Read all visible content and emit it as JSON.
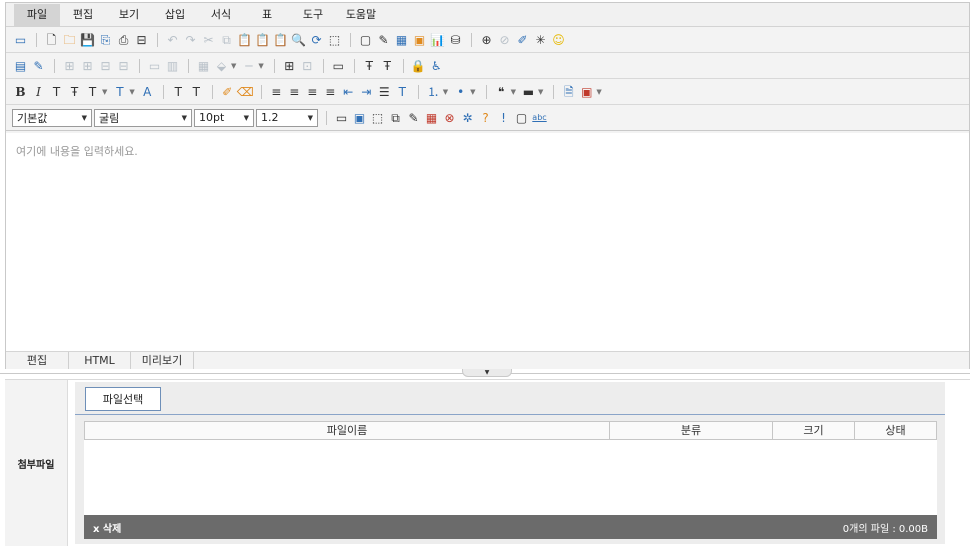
{
  "menu": [
    {
      "label": "파일",
      "name": "menu-file",
      "active": true
    },
    {
      "label": "편집",
      "name": "menu-edit"
    },
    {
      "label": "보기",
      "name": "menu-view"
    },
    {
      "label": "삽입",
      "name": "menu-insert"
    },
    {
      "label": "서식",
      "name": "menu-format"
    },
    {
      "label": "표",
      "name": "menu-table"
    },
    {
      "label": "도구",
      "name": "menu-tools"
    },
    {
      "label": "도움말",
      "name": "menu-help"
    }
  ],
  "toolbar1": [
    {
      "icon": "▭",
      "name": "open-icon",
      "cls": "g-blue"
    },
    {
      "sep": true
    },
    {
      "icon": "🗋",
      "name": "new-document-icon",
      "cls": "g-dark"
    },
    {
      "icon": "🗀",
      "name": "template-icon",
      "cls": "g-orange"
    },
    {
      "icon": "💾",
      "name": "save-icon",
      "cls": "g-blue"
    },
    {
      "icon": "⎘",
      "name": "save-as-icon",
      "cls": "g-blue"
    },
    {
      "icon": "⎙",
      "name": "print-icon",
      "cls": "g-dark"
    },
    {
      "icon": "⊟",
      "name": "page-setup-icon",
      "cls": "g-dark"
    },
    {
      "sep": true
    },
    {
      "icon": "↶",
      "name": "undo-icon",
      "cls": "dis"
    },
    {
      "icon": "↷",
      "name": "redo-icon",
      "cls": "dis"
    },
    {
      "icon": "✂",
      "name": "cut-icon",
      "cls": "dis"
    },
    {
      "icon": "⧉",
      "name": "copy-icon",
      "cls": "dis"
    },
    {
      "icon": "📋",
      "name": "paste-icon",
      "cls": "dis"
    },
    {
      "icon": "📋",
      "name": "paste-special-icon",
      "cls": "g-orange"
    },
    {
      "icon": "📋",
      "name": "paste-text-icon",
      "cls": "g-orange"
    },
    {
      "icon": "🔍",
      "name": "find-icon",
      "cls": "g-dark"
    },
    {
      "icon": "⟳",
      "name": "replace-icon",
      "cls": "g-blue"
    },
    {
      "icon": "⬚",
      "name": "select-all-icon",
      "cls": "g-dark"
    },
    {
      "sep": true
    },
    {
      "icon": "▢",
      "name": "image-icon",
      "cls": "g-dark"
    },
    {
      "icon": "✎",
      "name": "edit-image-icon",
      "cls": "g-dark"
    },
    {
      "icon": "▦",
      "name": "background-image-icon",
      "cls": "g-blue"
    },
    {
      "icon": "▣",
      "name": "media-icon",
      "cls": "g-orange"
    },
    {
      "icon": "📊",
      "name": "chart-icon",
      "cls": "g-blue"
    },
    {
      "icon": "⛁",
      "name": "link-icon",
      "cls": "g-dark"
    },
    {
      "sep": true
    },
    {
      "icon": "⊕",
      "name": "hyperlink-icon",
      "cls": "g-dark"
    },
    {
      "icon": "⊘",
      "name": "unlink-icon",
      "cls": "dis"
    },
    {
      "icon": "✐",
      "name": "pen-icon",
      "cls": "g-blue"
    },
    {
      "icon": "✳",
      "name": "special-char-icon",
      "cls": "g-dark"
    },
    {
      "icon": "☺",
      "name": "emoticon-icon",
      "cls": "g-yellow"
    }
  ],
  "toolbar2": [
    {
      "icon": "▤",
      "name": "table-icon",
      "cls": "g-blue"
    },
    {
      "icon": "✎",
      "name": "table-edit-icon",
      "cls": "g-blue"
    },
    {
      "sep": true
    },
    {
      "icon": "⊞",
      "name": "insert-row-icon",
      "cls": "dis"
    },
    {
      "icon": "⊞",
      "name": "insert-column-icon",
      "cls": "dis"
    },
    {
      "icon": "⊟",
      "name": "delete-row-icon",
      "cls": "dis"
    },
    {
      "icon": "⊟",
      "name": "delete-column-icon",
      "cls": "dis"
    },
    {
      "sep": true
    },
    {
      "icon": "▭",
      "name": "merge-cells-icon",
      "cls": "dis"
    },
    {
      "icon": "▥",
      "name": "split-cells-icon",
      "cls": "dis"
    },
    {
      "sep": true
    },
    {
      "icon": "▦",
      "name": "cell-properties-icon",
      "cls": "dis"
    },
    {
      "icon": "⬙",
      "name": "cell-fill-icon",
      "cls": "dis"
    },
    {
      "drop": true
    },
    {
      "icon": "─",
      "name": "cell-border-icon",
      "cls": "dis"
    },
    {
      "drop": true
    },
    {
      "sep": true
    },
    {
      "icon": "⊞",
      "name": "table-grid-icon",
      "cls": "g-dark"
    },
    {
      "icon": "⊡",
      "name": "table-outline-icon",
      "cls": "dis"
    },
    {
      "sep": true
    },
    {
      "icon": "▭",
      "name": "layer-icon",
      "cls": "g-dark"
    },
    {
      "sep": true
    },
    {
      "icon": "Ŧ",
      "name": "text-style-icon",
      "cls": "g-dark"
    },
    {
      "icon": "Ŧ",
      "name": "text-style-clear-icon",
      "cls": "g-dark"
    },
    {
      "sep": true
    },
    {
      "icon": "🔒",
      "name": "lock-icon",
      "cls": "g-orange"
    },
    {
      "icon": "♿",
      "name": "accessibility-icon",
      "cls": "g-blue"
    }
  ],
  "toolbar3": [
    {
      "icon": "B",
      "name": "bold-icon",
      "cls": "g-dark"
    },
    {
      "icon": "I",
      "name": "italic-icon",
      "cls": "g-dark"
    },
    {
      "icon": "T",
      "name": "underline-icon",
      "cls": "g-dark"
    },
    {
      "icon": "Ŧ",
      "name": "strikethrough-icon",
      "cls": "g-dark"
    },
    {
      "icon": "T",
      "name": "font-color-icon",
      "cls": "g-dark"
    },
    {
      "drop": true
    },
    {
      "icon": "T",
      "name": "background-color-icon",
      "cls": "g-blue"
    },
    {
      "drop": true
    },
    {
      "icon": "A",
      "name": "clear-format-icon",
      "cls": "g-blue"
    },
    {
      "sep": true
    },
    {
      "icon": "T",
      "name": "subscript-icon",
      "cls": "g-dark"
    },
    {
      "icon": "T",
      "name": "superscript-icon",
      "cls": "g-dark"
    },
    {
      "sep": true
    },
    {
      "icon": "✐",
      "name": "format-painter-icon",
      "cls": "g-orange"
    },
    {
      "icon": "⌫",
      "name": "eraser-icon",
      "cls": "g-orange"
    },
    {
      "sep": true
    },
    {
      "icon": "≡",
      "name": "align-left-icon",
      "cls": "g-dark"
    },
    {
      "icon": "≡",
      "name": "align-center-icon",
      "cls": "g-dark"
    },
    {
      "icon": "≡",
      "name": "align-right-icon",
      "cls": "g-dark"
    },
    {
      "icon": "≡",
      "name": "align-justify-icon",
      "cls": "g-dark"
    },
    {
      "icon": "⇤",
      "name": "outdent-icon",
      "cls": "g-blue"
    },
    {
      "icon": "⇥",
      "name": "indent-icon",
      "cls": "g-blue"
    },
    {
      "icon": "☰",
      "name": "line-height-icon",
      "cls": "g-dark"
    },
    {
      "icon": "T",
      "name": "paragraph-icon",
      "cls": "g-blue"
    },
    {
      "sep": true
    },
    {
      "icon": "⒈",
      "name": "ordered-list-icon",
      "cls": "g-blue"
    },
    {
      "drop": true
    },
    {
      "icon": "•",
      "name": "bullet-list-icon",
      "cls": "g-blue"
    },
    {
      "drop": true
    },
    {
      "sep": true
    },
    {
      "icon": "❝",
      "name": "blockquote-icon",
      "cls": "g-dark"
    },
    {
      "drop": true
    },
    {
      "icon": "▬",
      "name": "horizontal-rule-icon",
      "cls": "g-dark"
    },
    {
      "drop": true
    },
    {
      "sep": true
    },
    {
      "icon": "🗎",
      "name": "document-info-icon",
      "cls": "g-blue"
    },
    {
      "icon": "▣",
      "name": "widget-icon",
      "cls": "g-red"
    },
    {
      "drop": true
    }
  ],
  "toolbar4": [
    {
      "icon": "▭",
      "name": "page-break-icon",
      "cls": "g-dark"
    },
    {
      "icon": "▣",
      "name": "full-screen-icon",
      "cls": "g-blue"
    },
    {
      "icon": "⬚",
      "name": "maximize-icon",
      "cls": "g-dark"
    },
    {
      "icon": "⧉",
      "name": "copy-format-icon",
      "cls": "g-dark"
    },
    {
      "icon": "✎",
      "name": "spell-check-icon",
      "cls": "g-dark"
    },
    {
      "icon": "▦",
      "name": "pdf-icon",
      "cls": "g-red"
    },
    {
      "icon": "⊗",
      "name": "remove-icon",
      "cls": "g-red"
    },
    {
      "icon": "✲",
      "name": "settings-icon",
      "cls": "g-blue"
    },
    {
      "icon": "?",
      "name": "help-icon",
      "cls": "g-orange"
    },
    {
      "icon": "!",
      "name": "info-icon",
      "cls": "g-blue"
    },
    {
      "icon": "▢",
      "name": "preview-icon",
      "cls": "g-dark"
    },
    {
      "icon": "abc",
      "name": "abc-check-icon",
      "cls": "g-blue"
    }
  ],
  "selects": {
    "style": "기본값",
    "font": "굴림",
    "size": "10pt",
    "line_height": "1.2"
  },
  "editor": {
    "placeholder": "여기에 내용을 입력하세요."
  },
  "mode_tabs": [
    "편집",
    "HTML",
    "미리보기"
  ],
  "attachment": {
    "label": "첨부파일",
    "select_button": "파일선택",
    "columns": [
      "파일이름",
      "분류",
      "크기",
      "상태"
    ],
    "delete_label": "x 삭제",
    "summary": "0개의 파일 : 0.00B"
  }
}
